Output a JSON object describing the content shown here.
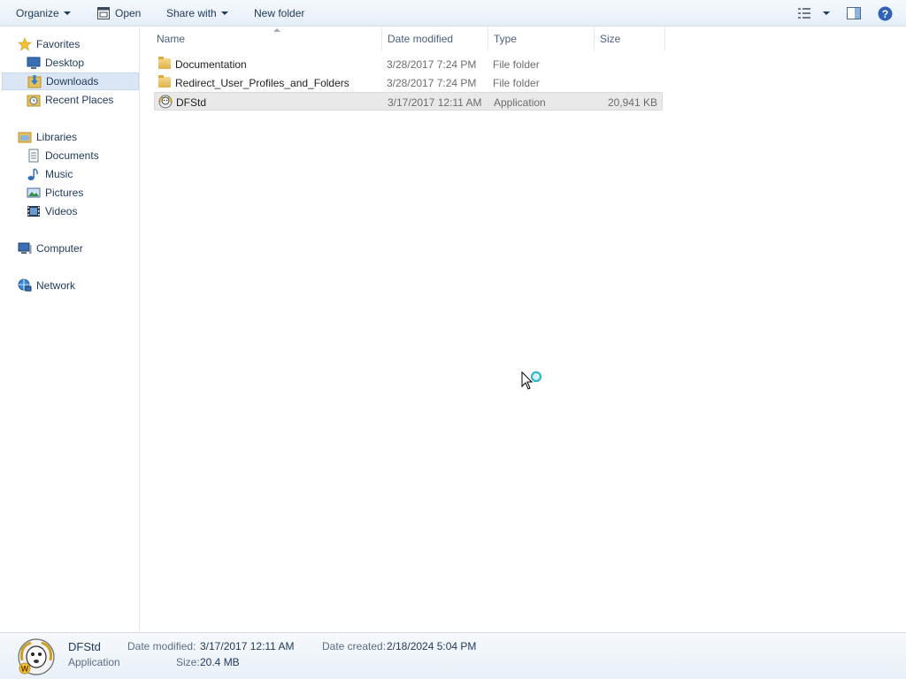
{
  "toolbar": {
    "organize": "Organize",
    "open": "Open",
    "share_with": "Share with",
    "new_folder": "New folder"
  },
  "nav": {
    "favorites": "Favorites",
    "desktop": "Desktop",
    "downloads": "Downloads",
    "recent_places": "Recent Places",
    "libraries": "Libraries",
    "documents": "Documents",
    "music": "Music",
    "pictures": "Pictures",
    "videos": "Videos",
    "computer": "Computer",
    "network": "Network"
  },
  "columns": {
    "name": "Name",
    "date_modified": "Date modified",
    "type": "Type",
    "size": "Size"
  },
  "files": [
    {
      "name": "Documentation",
      "date": "3/28/2017 7:24 PM",
      "type": "File folder",
      "size": ""
    },
    {
      "name": "Redirect_User_Profiles_and_Folders",
      "date": "3/28/2017 7:24 PM",
      "type": "File folder",
      "size": ""
    },
    {
      "name": "DFStd",
      "date": "3/17/2017 12:11 AM",
      "type": "Application",
      "size": "20,941 KB"
    }
  ],
  "details": {
    "name": "DFStd",
    "kind": "Application",
    "date_modified_label": "Date modified:",
    "date_modified": "3/17/2017 12:11 AM",
    "date_created_label": "Date created:",
    "date_created": "2/18/2024 5:04 PM",
    "size_label": "Size:",
    "size": "20.4 MB"
  },
  "colors": {
    "accent": "#1e395b",
    "selection": "#dbe7f5"
  }
}
